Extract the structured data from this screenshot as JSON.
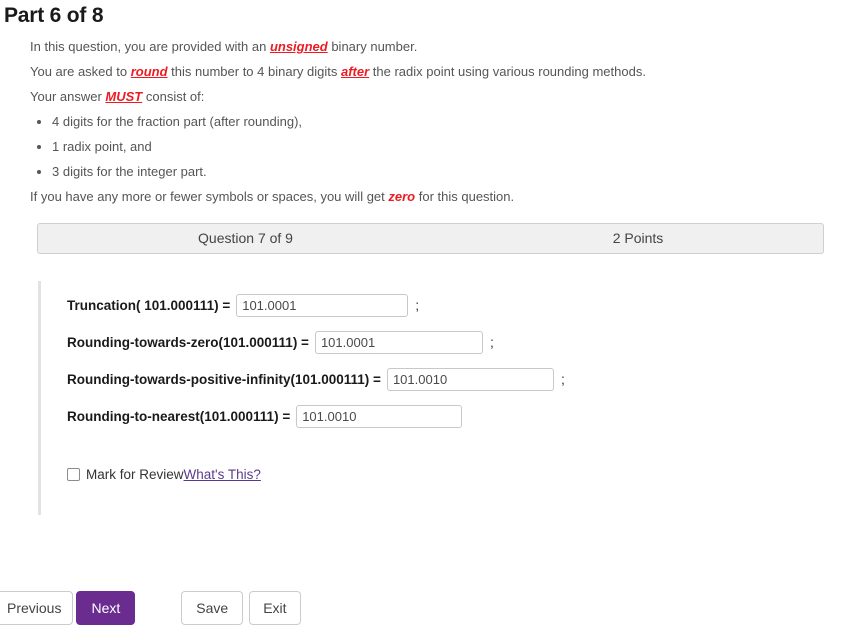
{
  "page": {
    "title": "Part 6 of 8"
  },
  "intro": {
    "line1_pre": "In this question, you are provided with an ",
    "line1_em": "unsigned",
    "line1_post": " binary number.",
    "line2_pre": "You are asked to ",
    "line2_em1": "round",
    "line2_mid": " this number to 4 binary digits ",
    "line2_em2": "after",
    "line2_post": " the radix point using various rounding methods.",
    "line3_pre": "Your answer ",
    "line3_em": "MUST",
    "line3_post": " consist of:",
    "bullets": [
      "4 digits for the fraction part (after rounding),",
      "1 radix point, and",
      "3 digits for the integer part."
    ],
    "line4_pre": "If you have any more or fewer symbols or spaces, you will get ",
    "line4_em": "zero",
    "line4_post": " for this question."
  },
  "question_bar": {
    "question_label": "Question 7 of 9",
    "points_label": "2 Points"
  },
  "answers": {
    "rows": [
      {
        "label": "Truncation( 101.000111) =",
        "value": "101.0001",
        "placeholder": "",
        "terminator": ";"
      },
      {
        "label": "Rounding-towards-zero(101.000111) =",
        "value": "101.0001",
        "placeholder": "",
        "terminator": ";"
      },
      {
        "label": "Rounding-towards-positive-infinity(101.000111) =",
        "value": "101.0010",
        "placeholder": "",
        "terminator": ";"
      },
      {
        "label": "Rounding-to-nearest(101.000111) =",
        "value": "101.0010",
        "placeholder": "",
        "terminator": ""
      }
    ]
  },
  "review": {
    "label": "Mark for Review",
    "link": "What's This?",
    "checked": false
  },
  "footer": {
    "previous": "Previous",
    "next": "Next",
    "save": "Save",
    "exit": "Exit"
  },
  "colors": {
    "emphasis_red": "#ee1b22",
    "next_button_purple": "#6a2c8f",
    "link_purple": "#5b3a8e",
    "bar_background": "#f0f0f0",
    "body_text": "#555555"
  }
}
